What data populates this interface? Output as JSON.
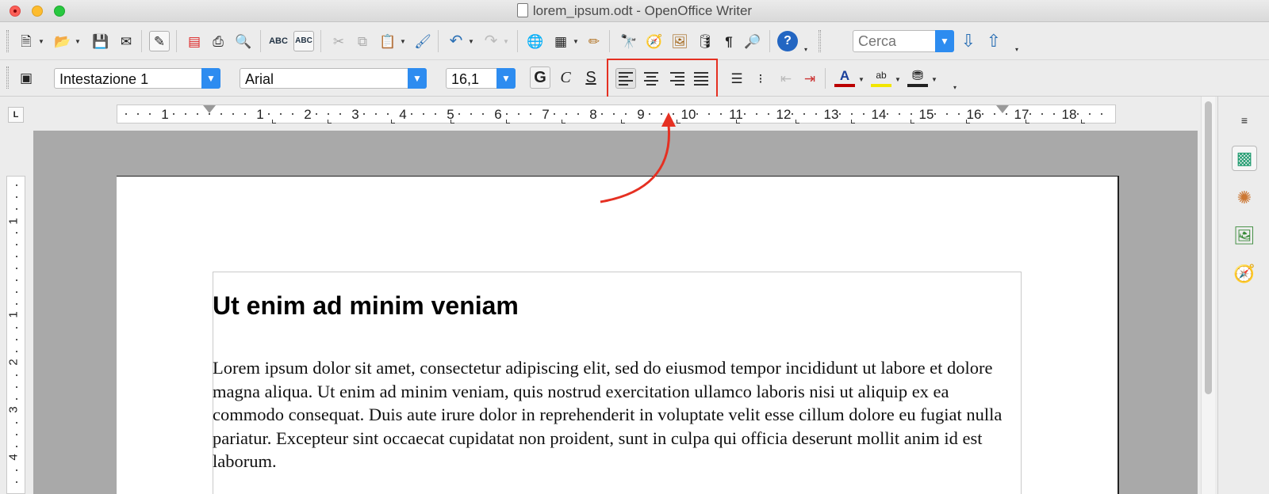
{
  "window": {
    "title": "lorem_ipsum.odt - OpenOffice Writer"
  },
  "standard_toolbar": {
    "icons": [
      "new-icon",
      "open-icon",
      "save-icon",
      "email-icon",
      "edit-mode-icon",
      "export-pdf-icon",
      "print-icon",
      "print-preview-icon",
      "spellcheck-icon",
      "autospellcheck-icon",
      "cut-icon",
      "copy-icon",
      "paste-icon",
      "clone-format-icon",
      "undo-icon",
      "redo-icon",
      "hyperlink-icon",
      "table-icon",
      "draw-functions-icon",
      "find-replace-icon",
      "navigator-icon",
      "gallery-icon",
      "data-sources-icon",
      "formatting-marks-icon",
      "zoom-icon",
      "help-icon"
    ],
    "search_placeholder": "Cerca"
  },
  "formatting_toolbar": {
    "paragraph_style": "Intestazione 1",
    "font_name": "Arial",
    "font_size": "16,1",
    "bold_label": "G",
    "italic_label": "C",
    "underline_label": "S",
    "align_buttons": [
      "align-left",
      "align-center",
      "align-right",
      "align-justify"
    ]
  },
  "ruler": {
    "horizontal_numbers": [
      "1",
      "1",
      "2",
      "3",
      "4",
      "5",
      "6",
      "7",
      "8",
      "9",
      "10",
      "11",
      "12",
      "13",
      "14",
      "15",
      "16",
      "17",
      "18"
    ],
    "vertical_numbers": [
      "1",
      "1",
      "2",
      "3",
      "4"
    ]
  },
  "document": {
    "heading": "Ut enim ad minim veniam",
    "body": "Lorem ipsum dolor sit amet, consectetur adipiscing elit, sed do eiusmod tempor incididunt ut labore et dolore magna aliqua. Ut enim ad minim veniam, quis nostrud exercitation ullamco laboris nisi ut aliquip ex ea commodo consequat. Duis aute irure dolor in reprehenderit in voluptate velit esse cillum dolore eu fugiat nulla pariatur. Excepteur sint occaecat cupidatat non proident, sunt in culpa qui officia deserunt mollit anim id est laborum."
  },
  "sidebar": {
    "icons": [
      "sidebar-menu-icon",
      "properties-icon",
      "styles-icon",
      "gallery-sidebar-icon",
      "navigator-sidebar-icon"
    ]
  },
  "colors": {
    "accent_blue": "#2d8cf0",
    "highlight_red": "#e53022"
  }
}
